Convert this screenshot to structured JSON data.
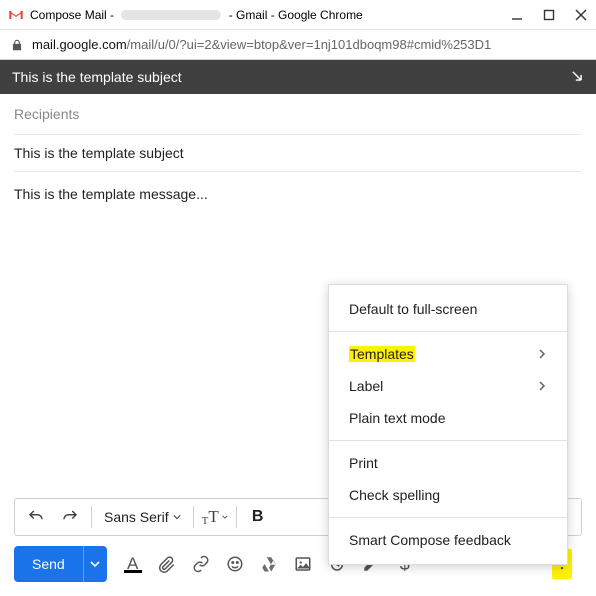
{
  "window": {
    "title_prefix": "Compose Mail - ",
    "title_suffix": " - Gmail - Google Chrome"
  },
  "address_bar": {
    "host": "mail.google.com",
    "path": "/mail/u/0/?ui=2&view=btop&ver=1nj101dboqm98#cmid%253D1"
  },
  "compose": {
    "header_subject": "This is the template subject",
    "recipients_placeholder": "Recipients",
    "subject_value": "This is the template subject",
    "body_text": "This is the template message..."
  },
  "format_toolbar": {
    "font_name": "Sans Serif"
  },
  "send": {
    "label": "Send"
  },
  "context_menu": {
    "full_screen": "Default to full-screen",
    "templates": "Templates",
    "label": "Label",
    "plain_text": "Plain text mode",
    "print": "Print",
    "check_spelling": "Check spelling",
    "smart_compose": "Smart Compose feedback"
  }
}
